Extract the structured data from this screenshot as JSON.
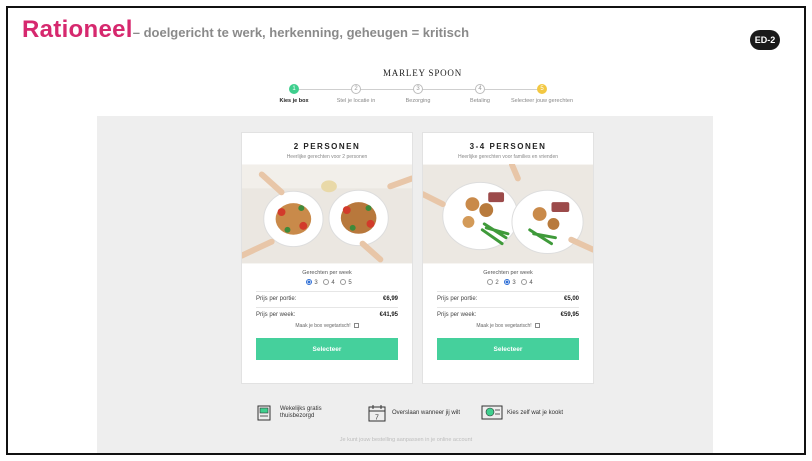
{
  "slide": {
    "title_strong": "Rationeel",
    "title_rest": "– doelgericht te werk, herkenning, geheugen = kritisch",
    "badge": "ED-2"
  },
  "brand": "MARLEY SPOON",
  "steps": [
    {
      "num": "1",
      "label": "Kies je box"
    },
    {
      "num": "2",
      "label": "Stel je locatie in"
    },
    {
      "num": "3",
      "label": "Bezorging"
    },
    {
      "num": "4",
      "label": "Betaling"
    },
    {
      "num": "5",
      "label": "Selecteer jouw gerechten"
    }
  ],
  "cards": [
    {
      "title": "2 PERSONEN",
      "subtitle": "Heerlijke gerechten voor 2 personen",
      "gpw_label": "Gerechten per week",
      "options": [
        "3",
        "4",
        "5"
      ],
      "selected_option": "3",
      "price_portion_label": "Prijs per portie:",
      "price_portion": "€6,99",
      "price_week_label": "Prijs per week:",
      "price_week": "€41,95",
      "veg_label": "Maak je box vegetarisch!",
      "button": "Selecteer"
    },
    {
      "title": "3-4 PERSONEN",
      "subtitle": "Heerlijke gerechten voor families en vrienden",
      "gpw_label": "Gerechten per week",
      "options": [
        "2",
        "3",
        "4"
      ],
      "selected_option": "3",
      "price_portion_label": "Prijs per portie:",
      "price_portion": "€5,00",
      "price_week_label": "Prijs per week:",
      "price_week": "€59,95",
      "veg_label": "Maak je box vegetarisch!",
      "button": "Selecteer"
    }
  ],
  "features": [
    {
      "icon": "delivery-box-icon",
      "text_line1": "Wekelijks gratis",
      "text_line2": "thuisbezorgd"
    },
    {
      "icon": "calendar-icon",
      "text_line1": "Overslaan wanneer jij wilt",
      "text_line2": ""
    },
    {
      "icon": "recipe-card-icon",
      "text_line1": "Kies zelf wat je kookt",
      "text_line2": ""
    }
  ],
  "footnote": "Je kunt jouw bestelling aanpassen in je online account",
  "colors": {
    "title_accent": "#d6286e",
    "primary_green": "#45d09c",
    "step_active": "#3fcf8e",
    "step_highlight": "#f3c842",
    "radio_selected": "#2f6fd6"
  }
}
